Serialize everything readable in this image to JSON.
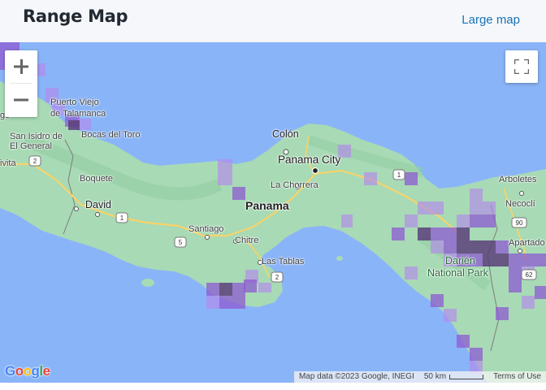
{
  "header": {
    "title": "Range Map",
    "large_map_link": "Large map"
  },
  "map": {
    "zoom_in_symbol": "+",
    "zoom_out_symbol": "−",
    "fullscreen_icon": "fullscreen-icon",
    "labels": {
      "puerto_viejo": "Puerto Viejo",
      "de_talamanca": "de Talamanca",
      "bocas_del_toro": "Bocas del Toro",
      "san_isidro": "San Isidro de",
      "el_general": "El General",
      "ivita": "ivita",
      "boquete": "Boquete",
      "david": "David",
      "colon": "Colón",
      "panama_city": "Panama City",
      "la_chorrera": "La Chorrera",
      "panama": "Panama",
      "santiago": "Santiago",
      "chitre": "Chitre",
      "las_tablas": "Las Tablas",
      "arboletes": "Arboletes",
      "necocli": "Necoclí",
      "apartado": "Apartado",
      "darien": "Darién",
      "national_park": "National Park",
      "partial_g": "go",
      "road_1_west": "1",
      "road_2_west": "2",
      "road_1_east": "1",
      "road_5": "5",
      "road_2_south": "2",
      "road_90": "90",
      "road_62": "62"
    },
    "google_logo": "Google",
    "attribution": {
      "map_data": "Map data ©2023 Google, INEGI",
      "scale": "50 km",
      "terms": "Terms of Use"
    },
    "colors": {
      "water": "#8ab4f8",
      "land": "#a8dab5",
      "range_light": "#b388eb",
      "range_mid": "#8e5ad1",
      "range_dark": "#5b3f7a"
    }
  }
}
